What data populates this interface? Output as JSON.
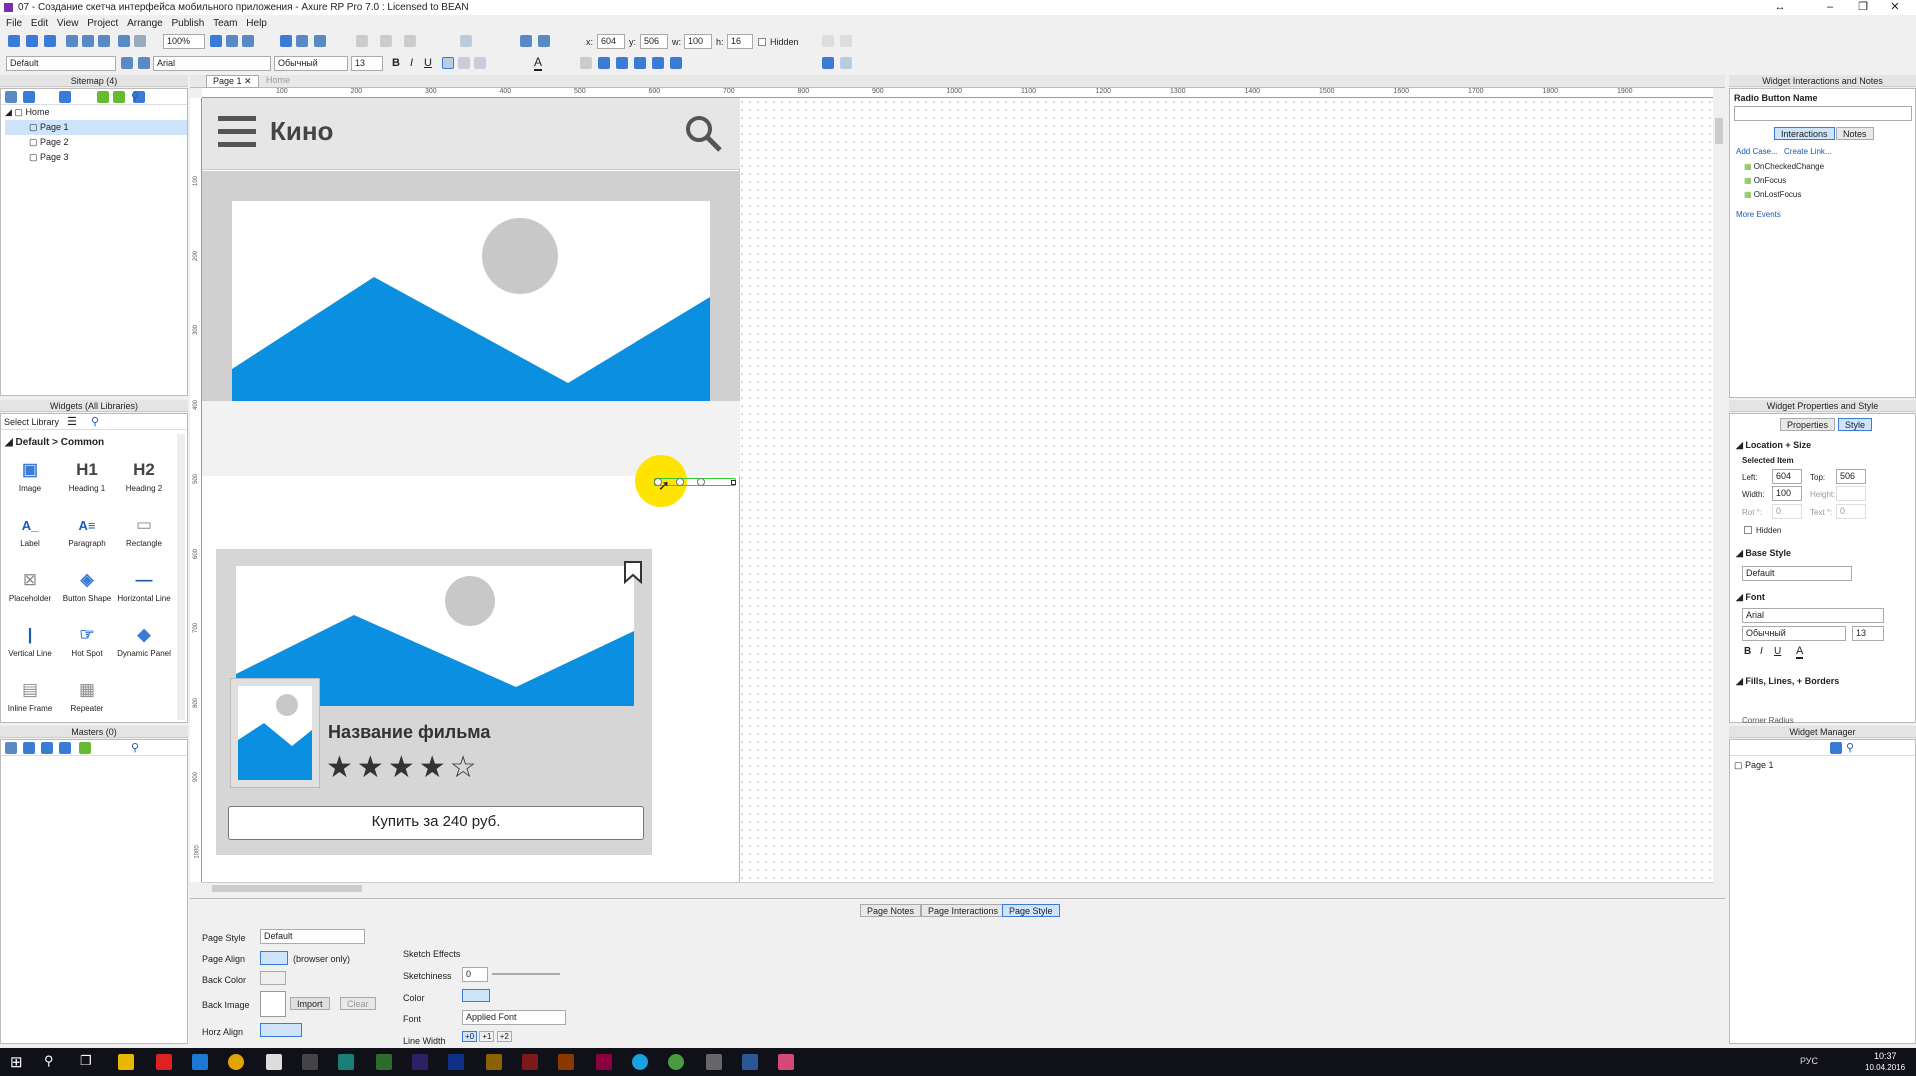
{
  "window": {
    "title": "07 - Создание скетча интерфейса мобильного приложения - Axure RP Pro 7.0 : Licensed to BEAN"
  },
  "menu": [
    "File",
    "Edit",
    "View",
    "Project",
    "Arrange",
    "Publish",
    "Team",
    "Help"
  ],
  "toolbar": {
    "zoom": "100%",
    "x_label": "x:",
    "x": "604",
    "y_label": "y:",
    "y": "506",
    "w_label": "w:",
    "w": "100",
    "h_label": "h:",
    "h": "16",
    "hidden": "Hidden",
    "style": "Default",
    "font": "Arial",
    "weight": "Обычный",
    "size": "13"
  },
  "sitemap": {
    "title": "Sitemap (4)",
    "root": "Home",
    "pages": [
      "Page 1",
      "Page 2",
      "Page 3"
    ],
    "selected": "Page 1"
  },
  "widgets": {
    "title": "Widgets (All Libraries)",
    "select_library": "Select Library",
    "category": "Default > Common",
    "items": [
      {
        "label": "Image",
        "glyph": "▣"
      },
      {
        "label": "Heading 1",
        "glyph": "H1"
      },
      {
        "label": "Heading 2",
        "glyph": "H2"
      },
      {
        "label": "Label",
        "glyph": "A_"
      },
      {
        "label": "Paragraph",
        "glyph": "A≡"
      },
      {
        "label": "Rectangle",
        "glyph": "▭"
      },
      {
        "label": "Placeholder",
        "glyph": "⊠"
      },
      {
        "label": "Button Shape",
        "glyph": "◈"
      },
      {
        "label": "Horizontal Line",
        "glyph": "—"
      },
      {
        "label": "Vertical Line",
        "glyph": "|"
      },
      {
        "label": "Hot Spot",
        "glyph": "☞"
      },
      {
        "label": "Dynamic Panel",
        "glyph": "◆"
      },
      {
        "label": "Inline Frame",
        "glyph": "▤"
      },
      {
        "label": "Repeater",
        "glyph": "▦"
      }
    ]
  },
  "masters": {
    "title": "Masters (0)"
  },
  "tabs": {
    "active": "Page 1",
    "other": "Home"
  },
  "ruler": {
    "top": [
      "100",
      "200",
      "300",
      "400",
      "500",
      "600",
      "700",
      "800",
      "900",
      "1000",
      "1100",
      "1200",
      "1300",
      "1400",
      "1500",
      "1600",
      "1700",
      "1800",
      "1900"
    ],
    "left": [
      "100",
      "200",
      "300",
      "400",
      "500",
      "600",
      "700",
      "800",
      "900",
      "1000"
    ]
  },
  "mockup": {
    "app_title": "Кино",
    "movie_title": "Название фильма",
    "rating": 4,
    "rating_max": 5,
    "buy_label": "Купить за 240 руб.",
    "accent": "#0b8fe0"
  },
  "interactions": {
    "panel_title": "Widget Interactions and Notes",
    "name_label": "Radio Button Name",
    "tab_interactions": "Interactions",
    "tab_notes": "Notes",
    "add_case": "Add Case...",
    "create_link": "Create Link...",
    "events": [
      "OnCheckedChange",
      "OnFocus",
      "OnLostFocus"
    ],
    "more": "More Events"
  },
  "properties": {
    "panel_title": "Widget Properties and Style",
    "tab_properties": "Properties",
    "tab_style": "Style",
    "location_size": "Location + Size",
    "selected_item": "Selected Item",
    "left_label": "Left:",
    "left": "604",
    "top_label": "Top:",
    "top": "506",
    "width_label": "Width:",
    "width": "100",
    "height_label": "Height:",
    "rot_label": "Rot °:",
    "rot": "0",
    "text_label": "Text °:",
    "text": "0",
    "hidden": "Hidden",
    "base_style": "Base Style",
    "base_style_value": "Default",
    "font_section": "Font",
    "font": "Arial",
    "weight": "Обычный",
    "size": "13",
    "fills": "Fills, Lines, + Borders",
    "corner": "Corner Radius"
  },
  "manager": {
    "title": "Widget Manager",
    "item": "Page 1"
  },
  "bottom": {
    "tabs": [
      "Page Notes",
      "Page Interactions",
      "Page Style"
    ],
    "active": "Page Style",
    "page_style_label": "Page Style",
    "page_style_value": "Default",
    "page_align": "Page Align",
    "browser_only": "(browser only)",
    "back_color": "Back Color",
    "back_image": "Back Image",
    "import": "Import",
    "clear": "Clear",
    "horz_align": "Horz Align",
    "sketch_effects": "Sketch Effects",
    "sketchiness": "Sketchiness",
    "sketchiness_value": "0",
    "color": "Color",
    "font": "Font",
    "font_value": "Applied Font",
    "line_width": "Line Width",
    "lw": [
      "+0",
      "+1",
      "+2"
    ]
  },
  "clock": {
    "time": "10:37",
    "date": "10.04.2016",
    "lang": "РУС"
  }
}
